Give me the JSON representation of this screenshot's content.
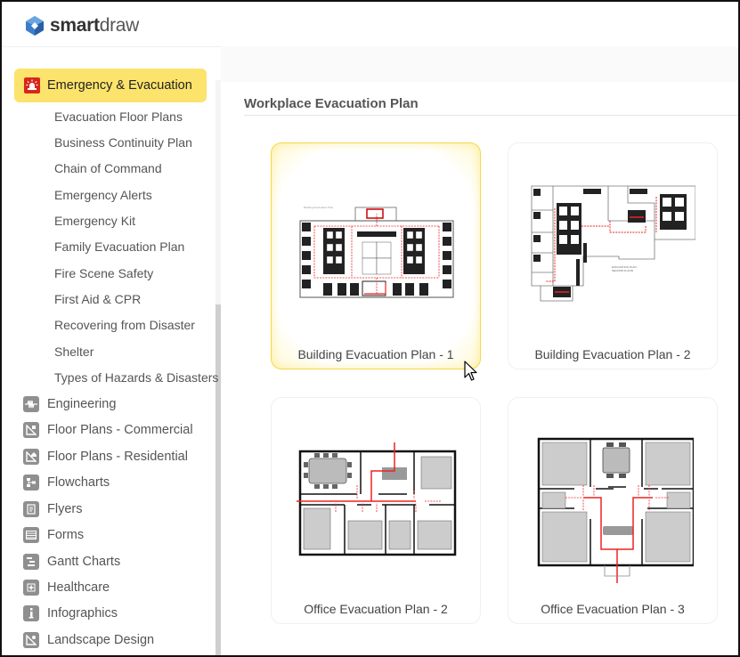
{
  "app": {
    "logo_bold": "smart",
    "logo_light": "draw"
  },
  "sidebar": {
    "active_category": {
      "label": "Emergency & Evacuation",
      "icon": "siren-icon",
      "color": "#d9261c",
      "highlight": "#fce36b"
    },
    "subcategories": [
      "Evacuation Floor Plans",
      "Business Continuity Plan",
      "Chain of Command",
      "Emergency Alerts",
      "Emergency Kit",
      "Family Evacuation Plan",
      "Fire Scene Safety",
      "First Aid & CPR",
      "Recovering from Disaster",
      "Shelter",
      "Types of Hazards & Disasters"
    ],
    "categories": [
      {
        "label": "Engineering",
        "icon": "waveform-icon"
      },
      {
        "label": "Floor Plans - Commercial",
        "icon": "floorplan-commercial-icon"
      },
      {
        "label": "Floor Plans - Residential",
        "icon": "floorplan-residential-icon"
      },
      {
        "label": "Flowcharts",
        "icon": "flowchart-icon"
      },
      {
        "label": "Flyers",
        "icon": "flyer-icon"
      },
      {
        "label": "Forms",
        "icon": "form-icon"
      },
      {
        "label": "Gantt Charts",
        "icon": "gantt-icon"
      },
      {
        "label": "Healthcare",
        "icon": "plus-icon"
      },
      {
        "label": "Infographics",
        "icon": "info-icon"
      },
      {
        "label": "Landscape Design",
        "icon": "landscape-icon"
      }
    ]
  },
  "main": {
    "section_title": "Workplace Evacuation Plan",
    "templates": [
      {
        "caption": "Building Evacuation Plan - 1",
        "selected": true
      },
      {
        "caption": "Building Evacuation Plan - 2",
        "selected": false
      },
      {
        "caption": "Office Evacuation Plan - 2",
        "selected": false
      },
      {
        "caption": "Office Evacuation Plan - 3",
        "selected": false
      }
    ]
  }
}
